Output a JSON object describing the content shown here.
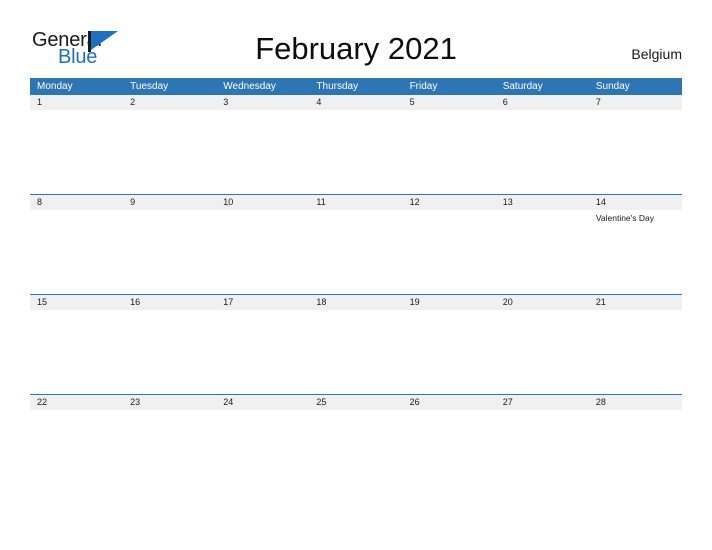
{
  "brand": {
    "name_part1": "General",
    "name_part2": "Blue",
    "accent_color": "#1f6fc0"
  },
  "header": {
    "title": "February 2021",
    "country": "Belgium"
  },
  "calendar": {
    "month": "February",
    "year": "2021",
    "header_color": "#2e75b6",
    "daynum_band_color": "#f0f0f0",
    "weekdays": [
      "Monday",
      "Tuesday",
      "Wednesday",
      "Thursday",
      "Friday",
      "Saturday",
      "Sunday"
    ],
    "weeks": [
      {
        "days": [
          {
            "num": "1",
            "event": ""
          },
          {
            "num": "2",
            "event": ""
          },
          {
            "num": "3",
            "event": ""
          },
          {
            "num": "4",
            "event": ""
          },
          {
            "num": "5",
            "event": ""
          },
          {
            "num": "6",
            "event": ""
          },
          {
            "num": "7",
            "event": ""
          }
        ]
      },
      {
        "days": [
          {
            "num": "8",
            "event": ""
          },
          {
            "num": "9",
            "event": ""
          },
          {
            "num": "10",
            "event": ""
          },
          {
            "num": "11",
            "event": ""
          },
          {
            "num": "12",
            "event": ""
          },
          {
            "num": "13",
            "event": ""
          },
          {
            "num": "14",
            "event": "Valentine's Day"
          }
        ]
      },
      {
        "days": [
          {
            "num": "15",
            "event": ""
          },
          {
            "num": "16",
            "event": ""
          },
          {
            "num": "17",
            "event": ""
          },
          {
            "num": "18",
            "event": ""
          },
          {
            "num": "19",
            "event": ""
          },
          {
            "num": "20",
            "event": ""
          },
          {
            "num": "21",
            "event": ""
          }
        ]
      },
      {
        "days": [
          {
            "num": "22",
            "event": ""
          },
          {
            "num": "23",
            "event": ""
          },
          {
            "num": "24",
            "event": ""
          },
          {
            "num": "25",
            "event": ""
          },
          {
            "num": "26",
            "event": ""
          },
          {
            "num": "27",
            "event": ""
          },
          {
            "num": "28",
            "event": ""
          }
        ]
      }
    ]
  }
}
